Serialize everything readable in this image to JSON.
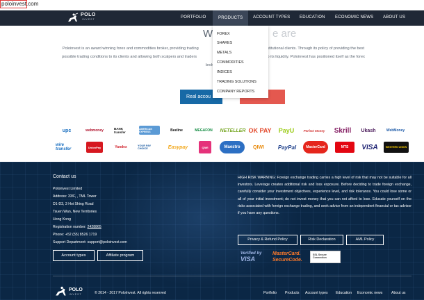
{
  "address_bar": {
    "url": "poloinvest.com"
  },
  "nav": {
    "logo_text": "POLO",
    "logo_sub": "INVEST",
    "items": [
      "PORTFOLIO",
      "PRODUCTS",
      "ACCOUNT TYPES",
      "EDUCATION",
      "ECONOMIC NEWS",
      "ABOUT US"
    ],
    "active": "PRODUCTS"
  },
  "products_menu": [
    "FOREX",
    "SHARES",
    "METALS",
    "COMMODITIES",
    "INDICES",
    "TRADING SOLUTIONS",
    "COMPANY REPORTS"
  ],
  "intro": {
    "title_visible": "W",
    "title_tail": "e are",
    "paragraph_line1": "Poloinvest is an award winning forex and commodities broker, providing trading",
    "paragraph_line1_tail": "d institutional clients. Through its policy of providing the best",
    "paragraph_line2": "possible trading conditions to its clients and allowing both scalpers and traders",
    "paragraph_line2_tail": "ess to its liquidity. Poloinvest has positioned itself as the forex",
    "paragraph_line3": "broker of",
    "button_real": "Real accou"
  },
  "payment_row1": [
    "upc",
    "webmoney",
    "BANK transfer",
    "AMERICAN EXPRESS",
    "Beeline",
    "MEGAFON",
    "NETELLER",
    "OK PAY",
    "PayU",
    "Perfect Money",
    "Skrill",
    "Ukash",
    "WebMoney"
  ],
  "payment_row2": [
    "wire transfer",
    "UnionPay",
    "Yandex",
    "YOUR PAY CHOICE",
    "Easypay",
    "QIWI",
    "Maestro",
    "QIWI",
    "PayPal",
    "MasterCard",
    "MTS",
    "VISA",
    "WESTERN UNION"
  ],
  "footer": {
    "contact_title": "Contact us",
    "contact_lines": [
      "Poloinvest Limited",
      "Address: 33/F, , TML Tower",
      "D1-D3, 3 Hoi Shing Road",
      "Tsuen Wan, New Territories",
      "Hong Kong",
      "Registration number: ",
      "Phone: +52 (55) 8526 1719",
      "Support Department: support@poloinvest.com"
    ],
    "registration_number": "2428865",
    "btn_account_types": "Account types",
    "btn_affiliate": "Affiliate program",
    "risk_warning": "HIGH RISK WARNING: Foreign exchange trading carries a high level of risk that may not be suitable for all investors. Leverage creates additional risk and loss exposure. Before deciding to trade foreign exchange, carefully consider your investment objectives, experience level, and risk tolerance. You could lose some or all of your initial investment; do not invest money that you can not afford to lose. Educate yourself on the risks associated with foreign exchange trading, and seek advice from an independent financial or tax advisor if you have any questions.",
    "btn_privacy": "Privacy & Refund Policy",
    "btn_risk": "Risk Declaration",
    "btn_aml": "AML Policy",
    "badge_visa_line1": "Verified by",
    "badge_visa_line2": "VISA",
    "badge_mc_line1": "MasterCard.",
    "badge_mc_line2": "SecureCode.",
    "badge_ssl": "SSL Secure Connection",
    "copyright": "© 2014 - 2017 PoloInvest. All rights reserved",
    "links": [
      "Portfolio",
      "Products",
      "Account types",
      "Education",
      "Economic news",
      "About us"
    ]
  },
  "colors": {
    "nav_bg": "#1f2836",
    "footer_bg": "#0b2745",
    "primary_button": "#1769a6",
    "accent_red": "#e4584f"
  }
}
